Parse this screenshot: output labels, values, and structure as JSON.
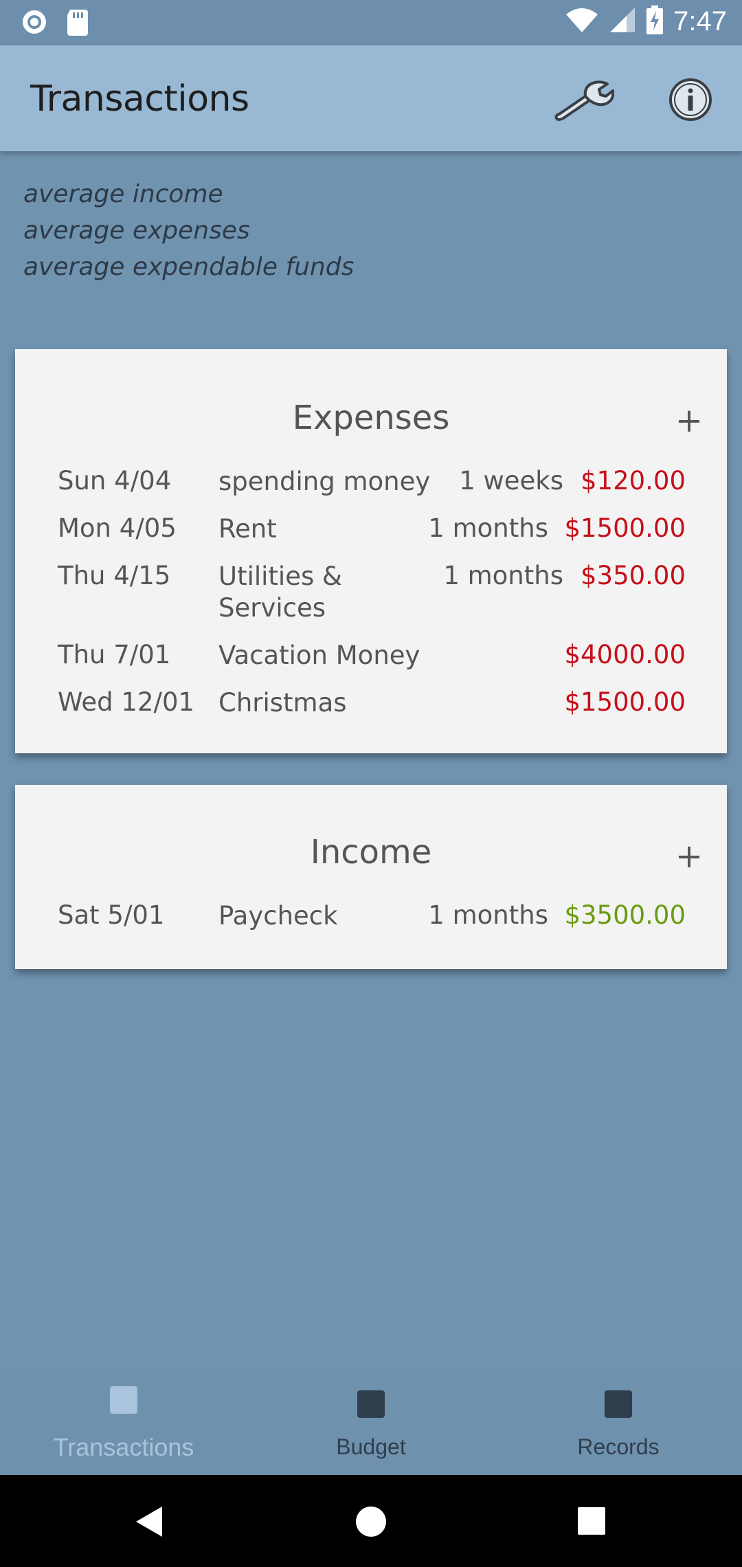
{
  "status_bar": {
    "time": "7:47",
    "left_icons": [
      "circle-notification-icon",
      "sd-card-icon"
    ],
    "right_icons": [
      "wifi-icon",
      "signal-icon",
      "battery-charging-icon"
    ]
  },
  "app_bar": {
    "title": "Transactions",
    "actions": [
      "wrench-icon",
      "info-icon"
    ]
  },
  "averages": {
    "income_label": "average income",
    "expenses_label": "average expenses",
    "expendable_label": "average expendable funds"
  },
  "expenses": {
    "title": "Expenses",
    "add_label": "+",
    "rows": [
      {
        "date": "Sun 4/04",
        "name": "spending money",
        "frequency": "1 weeks",
        "amount": "$120.00"
      },
      {
        "date": "Mon 4/05",
        "name": "Rent",
        "frequency": "1 months",
        "amount": "$1500.00"
      },
      {
        "date": "Thu 4/15",
        "name_line1": "Utilities &",
        "name_line2": "Services",
        "frequency": "1 months",
        "amount": "$350.00"
      },
      {
        "date": "Thu 7/01",
        "name": "Vacation Money",
        "frequency": "",
        "amount": "$4000.00"
      },
      {
        "date": "Wed 12/01",
        "name": "Christmas",
        "frequency": "",
        "amount": "$1500.00"
      }
    ]
  },
  "income": {
    "title": "Income",
    "add_label": "+",
    "rows": [
      {
        "date": "Sat 5/01",
        "name": "Paycheck",
        "frequency": "1 months",
        "amount": "$3500.00"
      }
    ]
  },
  "bottom_nav": {
    "active": "Transactions",
    "items": [
      {
        "label": "Transactions",
        "icon": "square-icon"
      },
      {
        "label": "Budget",
        "icon": "square-icon"
      },
      {
        "label": "Records",
        "icon": "square-icon"
      }
    ]
  },
  "colors": {
    "background": "#7093b0",
    "app_bar": "#98b8d3",
    "card": "#f3f3f3",
    "expense_amount": "#c5101a",
    "income_amount": "#6a9c10",
    "nav_active": "#a9c4dc",
    "nav_inactive": "#2f3e4c"
  },
  "system_nav": [
    "back-icon",
    "home-icon",
    "recents-icon"
  ]
}
